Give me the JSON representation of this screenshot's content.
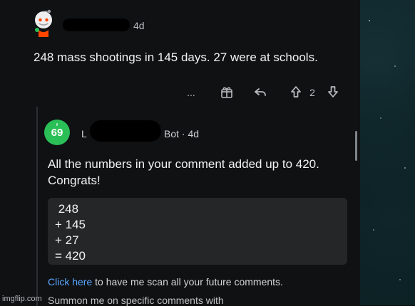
{
  "top_comment": {
    "time": "4d",
    "text": "248 mass shootings in 145 days.  27 were at schools."
  },
  "actions": {
    "more_label": "...",
    "vote_count": "2"
  },
  "reply": {
    "avatar_number": "69",
    "user_initial": "L",
    "user_suffix": "Bot · 4d",
    "text": "All the numbers in your comment added up to 420. Congrats!",
    "calc_lines": [
      " 248",
      "+ 145",
      "+ 27",
      "= 420"
    ],
    "footer_link": "Click here",
    "footer_rest": " to have me scan all your future comments.",
    "footer_line2": "Summon me on specific comments with"
  },
  "watermark": {
    "text": "imgflip.com"
  }
}
